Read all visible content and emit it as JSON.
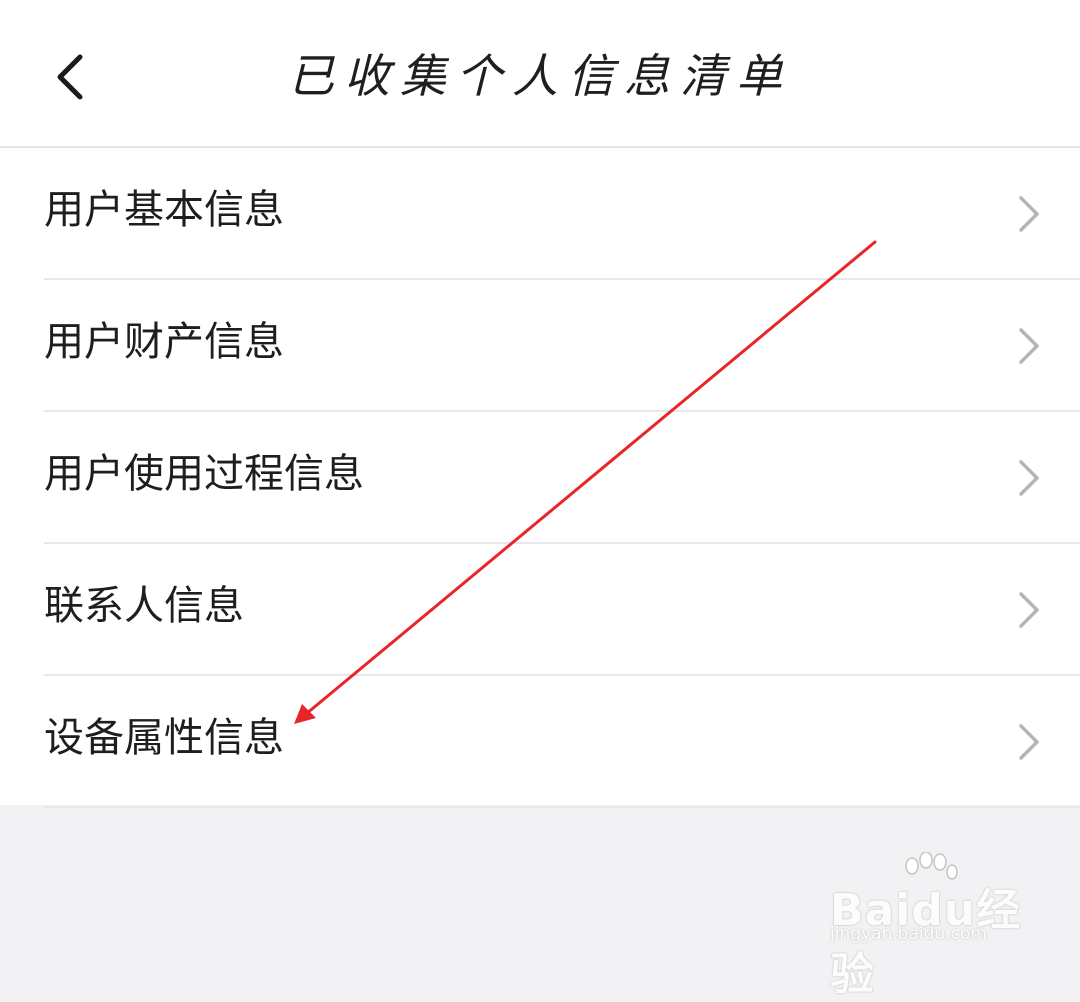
{
  "header": {
    "title": "已收集个人信息清单",
    "back_icon": "chevron-left-icon"
  },
  "menu": {
    "items": [
      {
        "label": "用户基本信息"
      },
      {
        "label": "用户财产信息"
      },
      {
        "label": "用户使用过程信息"
      },
      {
        "label": "联系人信息"
      },
      {
        "label": "设备属性信息"
      }
    ],
    "item_icon": "chevron-right-icon"
  },
  "annotation": {
    "arrow_color": "#e8262a"
  },
  "watermark": {
    "brand": "Baidu经验",
    "url": "jingyan.baidu.com"
  },
  "colors": {
    "background": "#f2f2f4",
    "surface": "#ffffff",
    "chevron": "#b5b5b8"
  }
}
